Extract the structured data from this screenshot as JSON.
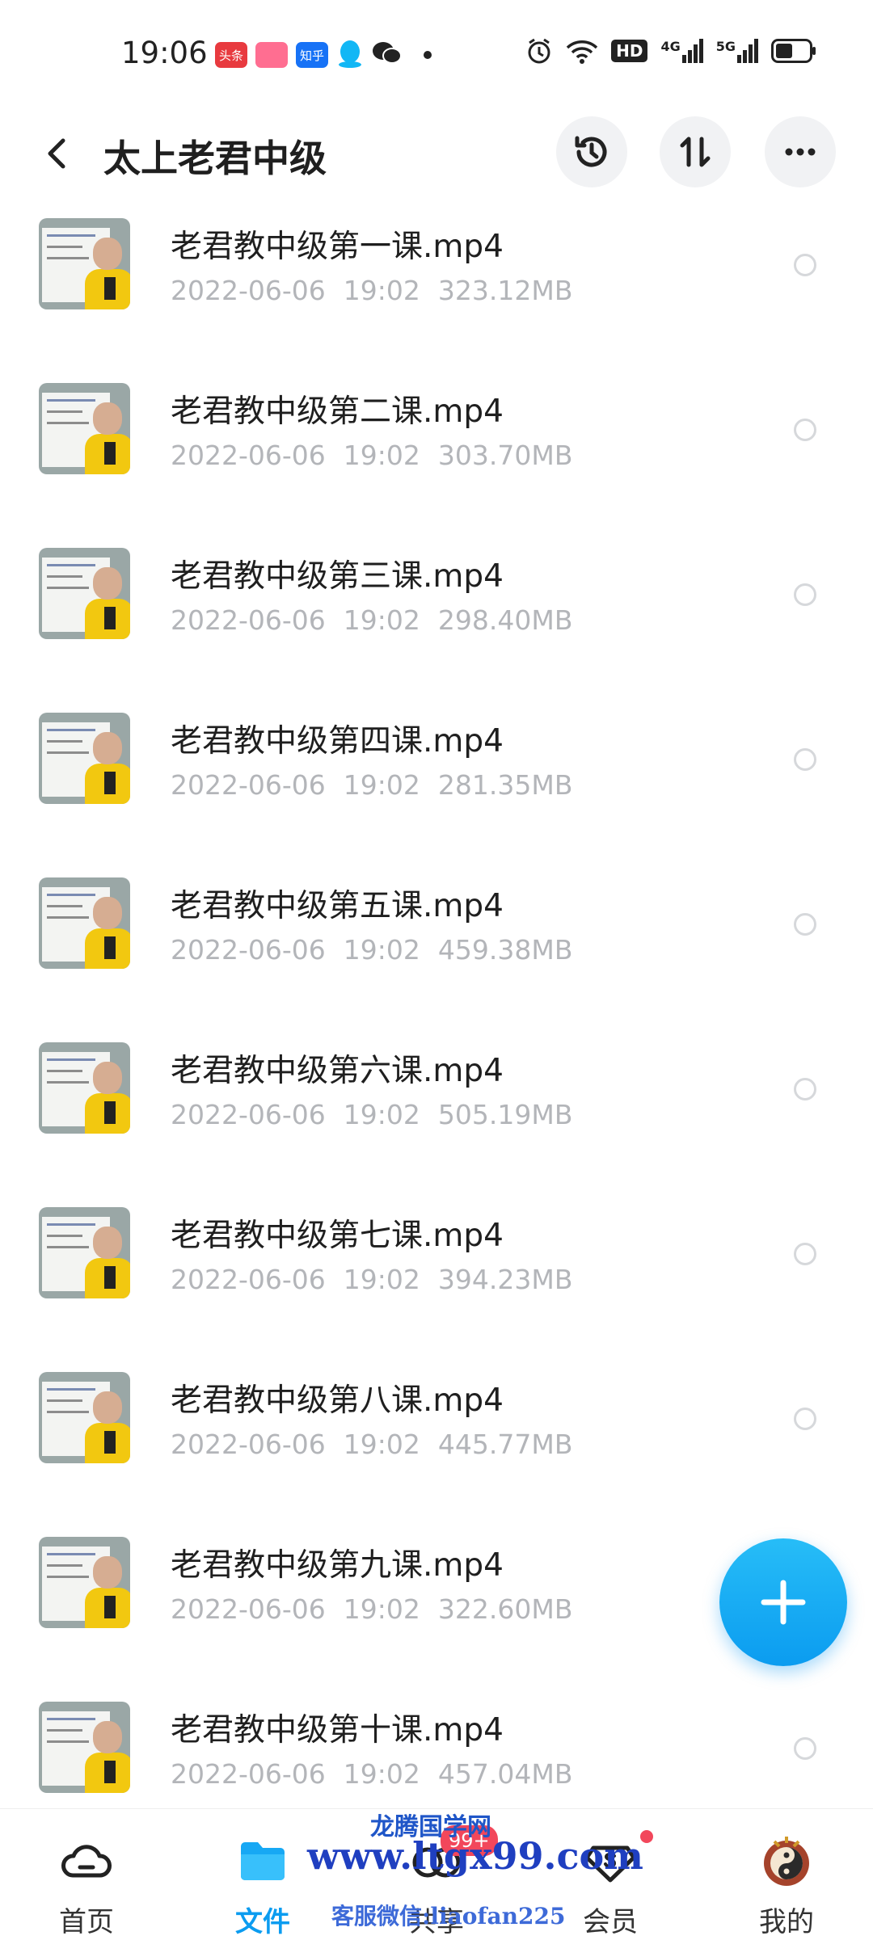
{
  "status_bar": {
    "time": "19:06",
    "apps": [
      {
        "icon": "toutiao-icon",
        "label": "头条",
        "color": "#e83a3f"
      },
      {
        "icon": "shop-icon",
        "label": "",
        "color": "#ff6e91"
      },
      {
        "icon": "zhihu-icon",
        "label": "知乎",
        "color": "#1772f6"
      },
      {
        "icon": "qq-icon",
        "label": "",
        "color": "#12b7f5"
      },
      {
        "icon": "wechat-icon",
        "label": "",
        "color": "#222222"
      }
    ],
    "network": {
      "hd": "HD",
      "sim1": "4G",
      "sim2": "5G"
    }
  },
  "header": {
    "title": "太上老君中级"
  },
  "files": [
    {
      "name": "老君教中级第一课.mp4",
      "date": "2022-06-06",
      "time": "19:02",
      "size": "323.12MB"
    },
    {
      "name": "老君教中级第二课.mp4",
      "date": "2022-06-06",
      "time": "19:02",
      "size": "303.70MB"
    },
    {
      "name": "老君教中级第三课.mp4",
      "date": "2022-06-06",
      "time": "19:02",
      "size": "298.40MB"
    },
    {
      "name": "老君教中级第四课.mp4",
      "date": "2022-06-06",
      "time": "19:02",
      "size": "281.35MB"
    },
    {
      "name": "老君教中级第五课.mp4",
      "date": "2022-06-06",
      "time": "19:02",
      "size": "459.38MB"
    },
    {
      "name": "老君教中级第六课.mp4",
      "date": "2022-06-06",
      "time": "19:02",
      "size": "505.19MB"
    },
    {
      "name": "老君教中级第七课.mp4",
      "date": "2022-06-06",
      "time": "19:02",
      "size": "394.23MB"
    },
    {
      "name": "老君教中级第八课.mp4",
      "date": "2022-06-06",
      "time": "19:02",
      "size": "445.77MB"
    },
    {
      "name": "老君教中级第九课.mp4",
      "date": "2022-06-06",
      "time": "19:02",
      "size": "322.60MB"
    },
    {
      "name": "老君教中级第十课.mp4",
      "date": "2022-06-06",
      "time": "19:02",
      "size": "457.04MB"
    }
  ],
  "bottom_nav": {
    "items": [
      {
        "label": "首页",
        "icon": "home-cloud-icon"
      },
      {
        "label": "文件",
        "icon": "folder-icon",
        "active": true
      },
      {
        "label": "共享",
        "icon": "share-icon",
        "badge": "99+"
      },
      {
        "label": "会员",
        "icon": "vip-icon"
      },
      {
        "label": "我的",
        "icon": "avatar-icon"
      }
    ]
  },
  "watermark": {
    "title": "龙腾国学网",
    "url": "www.ltgx99.com",
    "contact": "客服微信:liaofan225"
  },
  "colors": {
    "accent": "#0b9cf0",
    "meta_text": "#b3b5b9",
    "badge": "#f2475b"
  }
}
